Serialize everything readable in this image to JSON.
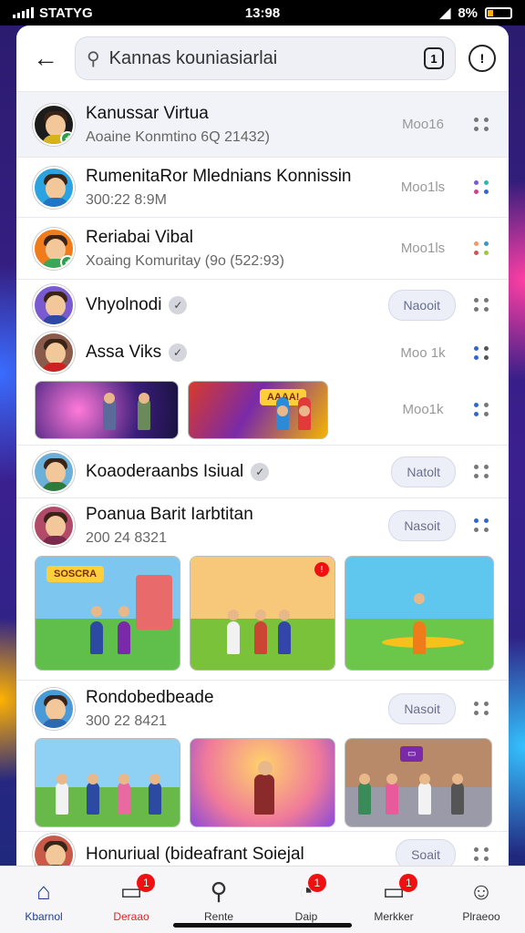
{
  "status_bar": {
    "carrier": "STATYG",
    "time": "13:98",
    "battery": "8%"
  },
  "search": {
    "value": "Kannas kouniasiarlai",
    "badge": "1"
  },
  "rows": [
    {
      "name": "Kanussar Virtua",
      "sub": "Aoaine Konmtino 6Q 21432)",
      "meta": "Moo16"
    },
    {
      "name": "RumenitaRor Mlednians Konnissin",
      "sub": "300:22 8:9M",
      "meta": "Moo1ls"
    },
    {
      "name": "Reriabai Vibal",
      "sub": "Xoaing Komuritay (9o (522:93)",
      "meta": "Moo1ls"
    },
    {
      "name": "Vhyolnodi",
      "pill": "Naooit"
    },
    {
      "name": "Assa Viks",
      "meta": "Moo 1k"
    },
    {
      "meta": "Moo1k"
    },
    {
      "name": "Koaoderaanbs Isiual",
      "pill": "Natolt"
    },
    {
      "name": "Poanua Barit Iarbtitan",
      "sub": "200 24 8321",
      "pill": "Nasoit"
    },
    {
      "name": "Rondobedbeade",
      "sub": "300 22 8421",
      "pill": "Nasoit"
    },
    {
      "name": "Honuriual (bideafrant Soiejal",
      "pill": "Soait"
    }
  ],
  "thumb_banners": {
    "t2": "AAAA!",
    "t4": "SOSCRA"
  },
  "tabs": [
    {
      "label": "Kbarnol",
      "count": ""
    },
    {
      "label": "Deraao",
      "count": "1"
    },
    {
      "label": "Rente",
      "count": ""
    },
    {
      "label": "Daip",
      "count": "1"
    },
    {
      "label": "Merkker",
      "count": "1"
    },
    {
      "label": "Plraeoo",
      "count": ""
    }
  ],
  "colors": {
    "accent": "#1f3d8f",
    "badge": "#e11111"
  }
}
